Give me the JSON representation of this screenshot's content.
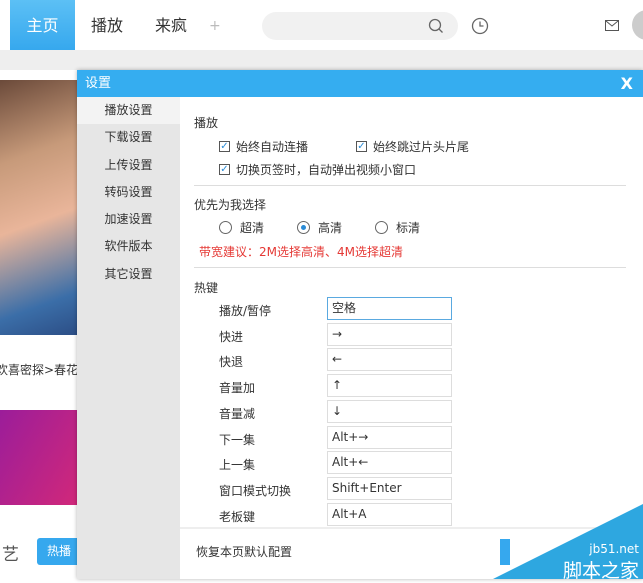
{
  "nav": {
    "tabs": [
      "主页",
      "播放",
      "来疯"
    ],
    "add": "+",
    "search_placeholder": ""
  },
  "background": {
    "caption": "欢喜密探>春花",
    "section_char": "艺",
    "hot_button": "热播"
  },
  "dialog": {
    "title": "设置",
    "close": "X",
    "sidebar": [
      "播放设置",
      "下载设置",
      "上传设置",
      "转码设置",
      "加速设置",
      "软件版本",
      "其它设置"
    ],
    "play": {
      "heading": "播放",
      "options": [
        {
          "label": "始终自动连播",
          "checked": true
        },
        {
          "label": "始终跳过片头片尾",
          "checked": true
        },
        {
          "label": "切换页签时，自动弹出视频小窗口",
          "checked": true
        }
      ]
    },
    "quality": {
      "heading": "优先为我选择",
      "options": [
        {
          "label": "超清",
          "selected": false
        },
        {
          "label": "高清",
          "selected": true
        },
        {
          "label": "标清",
          "selected": false
        }
      ],
      "tip": "带宽建议：2M选择高清、4M选择超清",
      "tip_color": "#e53935"
    },
    "hotkeys": {
      "heading": "热键",
      "items": [
        {
          "label": "播放/暂停",
          "value": "空格"
        },
        {
          "label": "快进",
          "value": "→"
        },
        {
          "label": "快退",
          "value": "←"
        },
        {
          "label": "音量加",
          "value": "↑"
        },
        {
          "label": "音量减",
          "value": "↓"
        },
        {
          "label": "下一集",
          "value": "Alt+→"
        },
        {
          "label": "上一集",
          "value": "Alt+←"
        },
        {
          "label": "窗口模式切换",
          "value": "Shift+Enter"
        },
        {
          "label": "老板键",
          "value": "Alt+A"
        }
      ]
    },
    "footer": {
      "reset": "恢复本页默认配置"
    }
  },
  "watermark": {
    "line1": "jb51.net",
    "line2": "脚本之家"
  },
  "colors": {
    "accent": "#35adf0"
  }
}
